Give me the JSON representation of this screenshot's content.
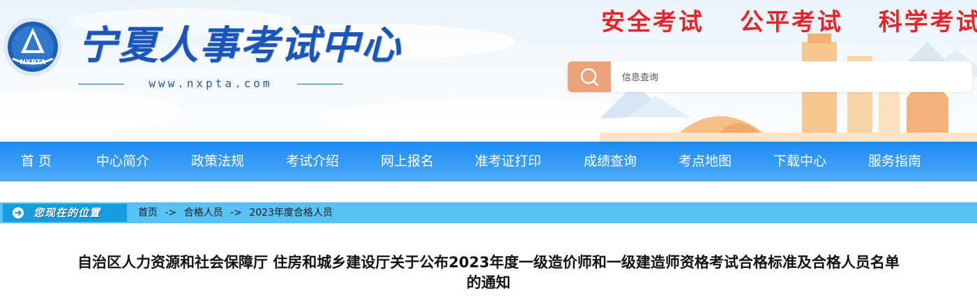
{
  "header": {
    "site_title": "宁夏人事考试中心",
    "site_url": "www.nxpta.com",
    "logo_text": "NXPTA",
    "slogans": [
      "安全考试",
      "公平考试",
      "科学考试"
    ],
    "search": {
      "placeholder": "信息查询",
      "icon": "search-icon"
    }
  },
  "nav": {
    "items": [
      "首  页",
      "中心简介",
      "政策法规",
      "考试介绍",
      "网上报名",
      "准考证打印",
      "成绩查询",
      "考点地图",
      "下载中心",
      "服务指南"
    ]
  },
  "breadcrumb": {
    "label": "您现在的位置",
    "path": [
      "首页",
      "合格人员",
      "2023年度合格人员"
    ],
    "separator": "->"
  },
  "article": {
    "title_line1": "自治区人力资源和社会保障厅 住房和城乡建设厅关于公布2023年度一级造价师和一级建造师资格考试合格标准及合格人员名单",
    "title_line2": "的通知"
  },
  "colors": {
    "nav_bg": "#2b93f4",
    "slogan": "#e8242a",
    "search_button": "#eba27a",
    "breadcrumb_bar": "#57c2f3",
    "title_text": "#1a55b8"
  }
}
